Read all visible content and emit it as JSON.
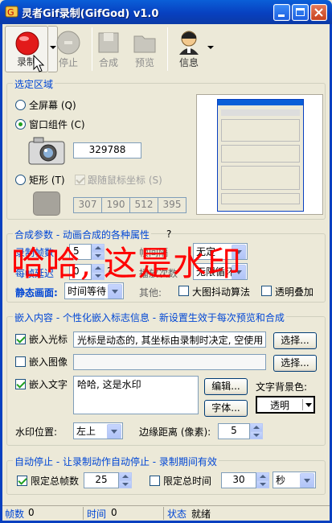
{
  "window": {
    "title": "灵者Gif录制(GifGod) v1.0"
  },
  "toolbar": {
    "record": "录制",
    "stop": "停止",
    "compose": "合成",
    "preview": "预览",
    "info": "信息"
  },
  "region": {
    "title": "选定区域",
    "fullscreen": "全屏幕 (Q)",
    "window_component": "窗口组件 (C)",
    "handle": "329788",
    "rect": "矩形 (T)",
    "follow_mouse": "跟随鼠标坐标 (S)",
    "x": "307",
    "y": "190",
    "w": "512",
    "h": "395"
  },
  "compose": {
    "title": "合成参数 - 动画合成的各种属性",
    "help": "?",
    "frames_label": "录制帧数",
    "frames_value": "5",
    "frame_speed_label": "帧间隔",
    "frame_speed_value": "无定",
    "per_frame_label": "每帧延迟",
    "per_frame_value": "0",
    "per_frame_q": "?",
    "loop_label": "播放次数",
    "loop_value": "无限循环",
    "static_label": "静态画面:",
    "static_value": "时间等待",
    "other_label": "其他:",
    "dither": "大图抖动算法",
    "transparent": "透明叠加"
  },
  "watermark_overlay": "哈哈, 这是水印",
  "embed": {
    "title": "嵌入内容 - 个性化嵌入标志信息 - 新设置生效于每次预览和合成",
    "cursor_label": "嵌入光标",
    "cursor_text": "光标是动态的, 其坐标由录制时决定, 空使用",
    "choose1": "选择...",
    "image_label": "嵌入图像",
    "choose2": "选择...",
    "text_label": "嵌入文字",
    "text_value": "哈哈, 这是水印",
    "edit": "编辑...",
    "font": "字体...",
    "bg_label": "文字背景色:",
    "bg_value": "透明",
    "pos_label": "水印位置:",
    "pos_value": "左上",
    "margin_label": "边缘距离 (像素):",
    "margin_value": "5"
  },
  "autostop": {
    "title": "自动停止 - 让录制动作自动停止 - 录制期间有效",
    "limit_frames": "限定总帧数",
    "limit_frames_value": "25",
    "limit_time": "限定总时间",
    "limit_time_value": "30",
    "unit": "秒"
  },
  "status": {
    "frames_label": "帧数",
    "frames_value": "0",
    "time_label": "时间",
    "time_value": "0",
    "state_label": "状态",
    "state_value": "就绪"
  }
}
